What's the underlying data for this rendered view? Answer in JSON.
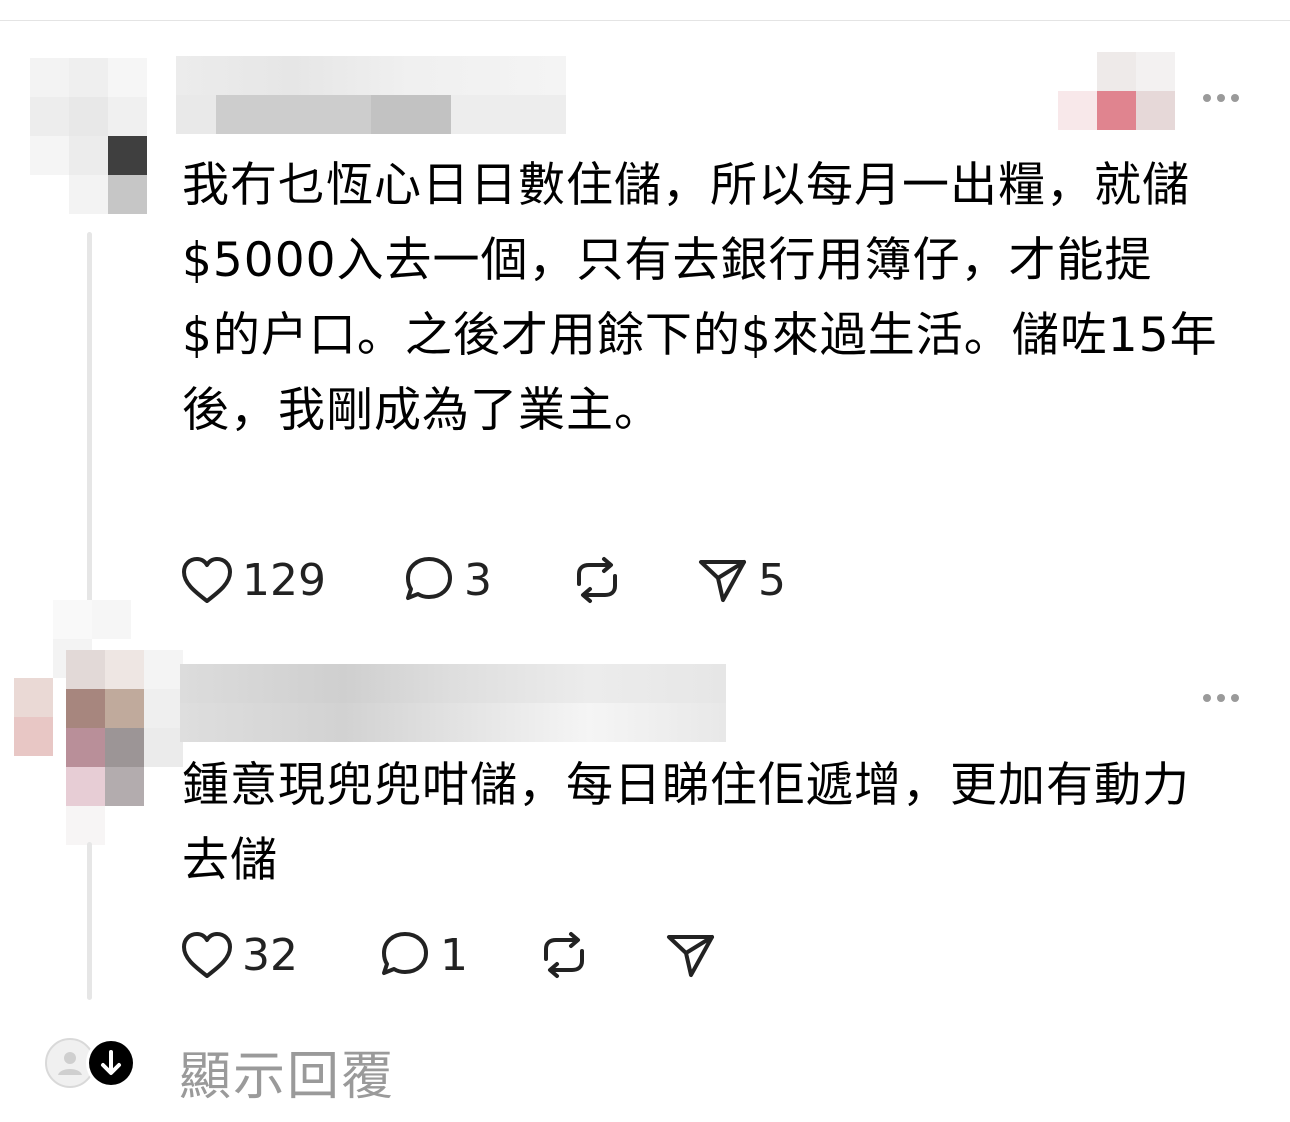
{
  "comments": [
    {
      "body": "我冇乜恆心日日數住儲，所以每月一出糧，就儲$5000入去一個，只有去銀行用簿仔，才能提$的户口。之後才用餘下的$來過生活。儲咗15年後，我剛成為了業主。",
      "likes": "129",
      "replies": "3",
      "shares": "5"
    },
    {
      "body": "鍾意現兜兜咁儲，每日睇住佢遞增，更加有動力去儲",
      "likes": "32",
      "replies": "1",
      "shares": ""
    }
  ],
  "show_replies_label": "顯示回覆",
  "icons": {
    "like": "heart-icon",
    "reply": "speech-bubble-icon",
    "repost": "repost-icon",
    "share": "send-icon",
    "more": "more-dots-icon",
    "expand": "arrow-down-icon"
  },
  "colors": {
    "text": "#000000",
    "muted": "#9a9a9a",
    "line": "#e6e6e6"
  }
}
